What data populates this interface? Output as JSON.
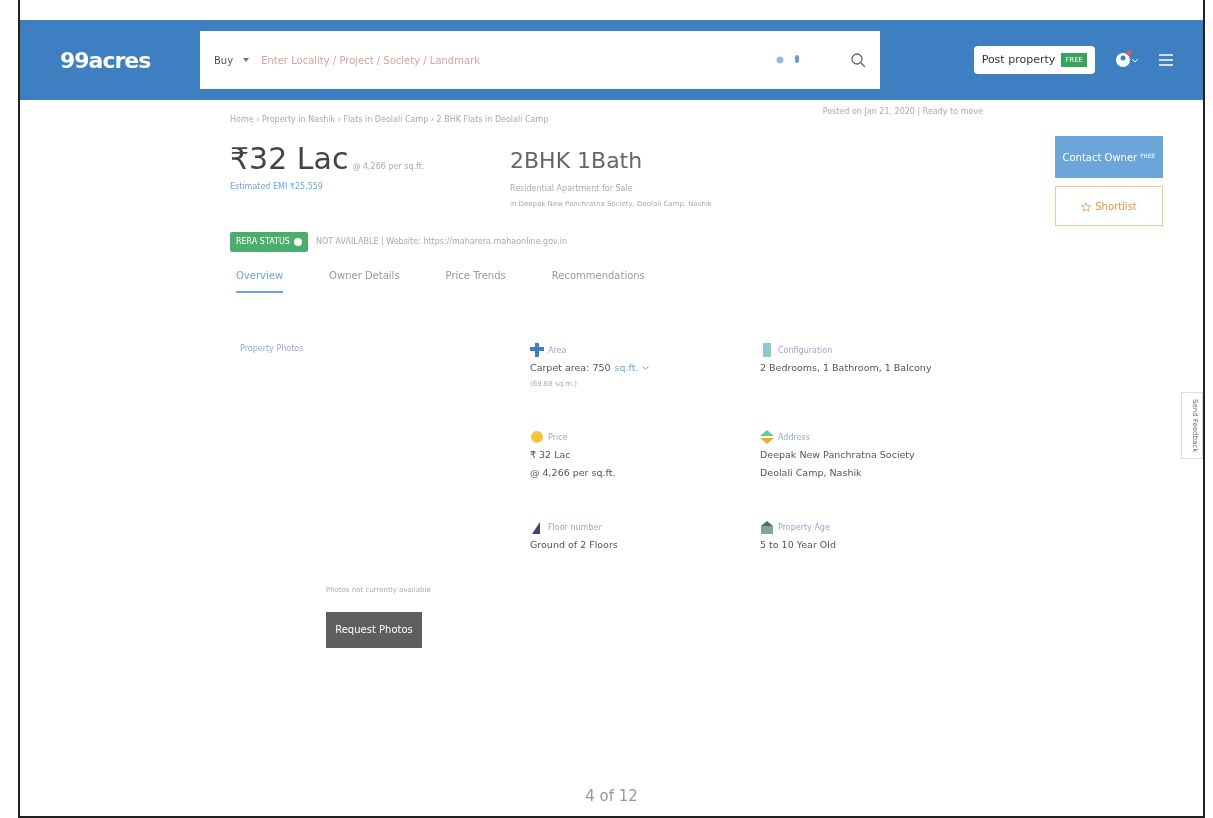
{
  "header": {
    "logo": "99acres",
    "search": {
      "category": "Buy",
      "placeholder": "Enter Locality / Project / Society / Landmark"
    },
    "post_button": {
      "label": "Post property",
      "badge": "FREE"
    }
  },
  "breadcrumb": "Home › Property in Nashik › Flats in Deolali Camp › 2 BHK Flats in Deolali Camp",
  "posted": "Posted on Jan 21, 2020  |  Ready to move",
  "listing": {
    "price": "₹32 Lac",
    "rate": "@ 4,266 per sq.ft.",
    "emi": "Estimated EMI ₹25,559",
    "title": "2BHK 1Bath",
    "subtitle": "Residential Apartment for Sale",
    "location": "in Deepak New Panchratna Society, Deolali Camp, Nashik"
  },
  "actions": {
    "contact": {
      "label": "Contact Owner",
      "badge": "FREE"
    },
    "shortlist": "Shortlist"
  },
  "rera": {
    "badge": "RERA STATUS",
    "status": "NOT AVAILABLE  |  Website: https://maharera.mahaonline.gov.in"
  },
  "tabs": [
    {
      "label": "Overview",
      "selected": true
    },
    {
      "label": "Owner Details",
      "selected": false
    },
    {
      "label": "Price Trends",
      "selected": false
    },
    {
      "label": "Recommendations",
      "selected": false
    }
  ],
  "photos": {
    "title": "Property Photos",
    "note": "Photos not currently available",
    "button": "Request Photos"
  },
  "details": [
    {
      "kind": "area",
      "label": "Area",
      "lines": [
        "Carpet area: 750"
      ],
      "unit": "sq.ft.",
      "sub": "(69.68 sq.m.)"
    },
    {
      "kind": "config",
      "label": "Configuration",
      "lines": [
        "2 Bedrooms, 1 Bathroom, 1 Balcony"
      ]
    },
    {
      "kind": "price",
      "label": "Price",
      "lines": [
        "₹ 32 Lac",
        "@ 4,266 per sq.ft."
      ]
    },
    {
      "kind": "address",
      "label": "Address",
      "lines": [
        "Deepak New Panchratna Society",
        "Deolali Camp, Nashik"
      ]
    },
    {
      "kind": "floor",
      "label": "Floor number",
      "lines": [
        "Ground of 2 Floors"
      ]
    },
    {
      "kind": "age",
      "label": "Property Age",
      "lines": [
        "5 to 10 Year Old"
      ]
    }
  ],
  "feedback": "Send Feedback",
  "page_number": "4 of 12"
}
